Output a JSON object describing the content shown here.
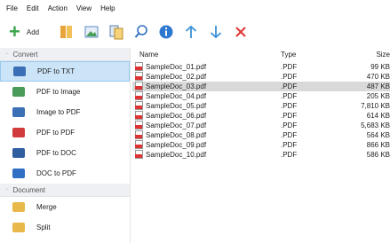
{
  "menu": [
    "File",
    "Edit",
    "Action",
    "View",
    "Help"
  ],
  "toolbar": {
    "add_label": "Add",
    "icons": [
      "folder-icon",
      "image-icon",
      "copy-icon",
      "search-icon",
      "info-icon",
      "arrow-up-icon",
      "arrow-down-icon",
      "delete-icon"
    ]
  },
  "sidebar": {
    "convert_header": "Convert",
    "document_header": "Document",
    "convert_items": [
      {
        "label": "PDF to TXT",
        "color": "#3b6fb6"
      },
      {
        "label": "PDF to Image",
        "color": "#4a9a5a"
      },
      {
        "label": "Image to PDF",
        "color": "#3b6fb6"
      },
      {
        "label": "PDF to PDF",
        "color": "#d23b3b"
      },
      {
        "label": "PDF to DOC",
        "color": "#2f5f9f"
      },
      {
        "label": "DOC to PDF",
        "color": "#2f6fc4"
      }
    ],
    "document_items": [
      {
        "label": "Merge",
        "color": "#e8b84a"
      },
      {
        "label": "Split",
        "color": "#e8b84a"
      }
    ]
  },
  "table": {
    "headers": [
      "Name",
      "Type",
      "Size"
    ],
    "rows": [
      {
        "name": "SampleDoc_01.pdf",
        "type": ".PDF",
        "size": "99 KB"
      },
      {
        "name": "SampleDoc_02.pdf",
        "type": ".PDF",
        "size": "470 KB"
      },
      {
        "name": "SampleDoc_03.pdf",
        "type": ".PDF",
        "size": "487 KB"
      },
      {
        "name": "SampleDoc_04.pdf",
        "type": ".PDF",
        "size": "205 KB"
      },
      {
        "name": "SampleDoc_05.pdf",
        "type": ".PDF",
        "size": "7,810 KB"
      },
      {
        "name": "SampleDoc_06.pdf",
        "type": ".PDF",
        "size": "614 KB"
      },
      {
        "name": "SampleDoc_07.pdf",
        "type": ".PDF",
        "size": "5,683 KB"
      },
      {
        "name": "SampleDoc_08.pdf",
        "type": ".PDF",
        "size": "564 KB"
      },
      {
        "name": "SampleDoc_09.pdf",
        "type": ".PDF",
        "size": "866 KB"
      },
      {
        "name": "SampleDoc_10.pdf",
        "type": ".PDF",
        "size": "586 KB"
      }
    ]
  }
}
